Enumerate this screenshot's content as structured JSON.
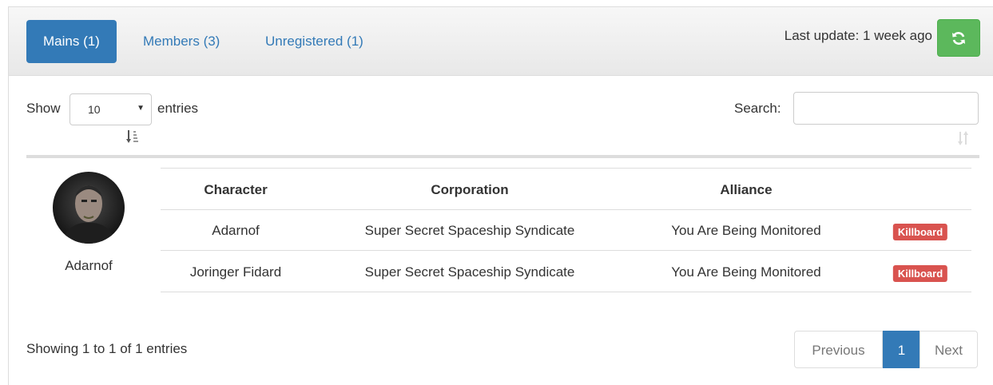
{
  "tabs": [
    {
      "label": "Mains (1)",
      "active": true
    },
    {
      "label": "Members (3)",
      "active": false
    },
    {
      "label": "Unregistered (1)",
      "active": false
    }
  ],
  "last_update": "Last update: 1 week ago",
  "refresh_icon": "refresh-icon",
  "length": {
    "show": "Show",
    "value": "10",
    "entries": "entries"
  },
  "search": {
    "label": "Search:",
    "value": ""
  },
  "main": {
    "name": "Adarnof"
  },
  "table": {
    "headers": [
      "Character",
      "Corporation",
      "Alliance"
    ],
    "rows": [
      {
        "character": "Adarnof",
        "corporation": "Super Secret Spaceship Syndicate",
        "alliance": "You Are Being Monitored",
        "link": "Killboard"
      },
      {
        "character": "Joringer Fidard",
        "corporation": "Super Secret Spaceship Syndicate",
        "alliance": "You Are Being Monitored",
        "link": "Killboard"
      }
    ]
  },
  "info": "Showing 1 to 1 of 1 entries",
  "pagination": {
    "previous": "Previous",
    "current": "1",
    "next": "Next"
  },
  "colors": {
    "primary": "#337ab7",
    "success": "#5cb85c",
    "danger": "#d9534f"
  }
}
